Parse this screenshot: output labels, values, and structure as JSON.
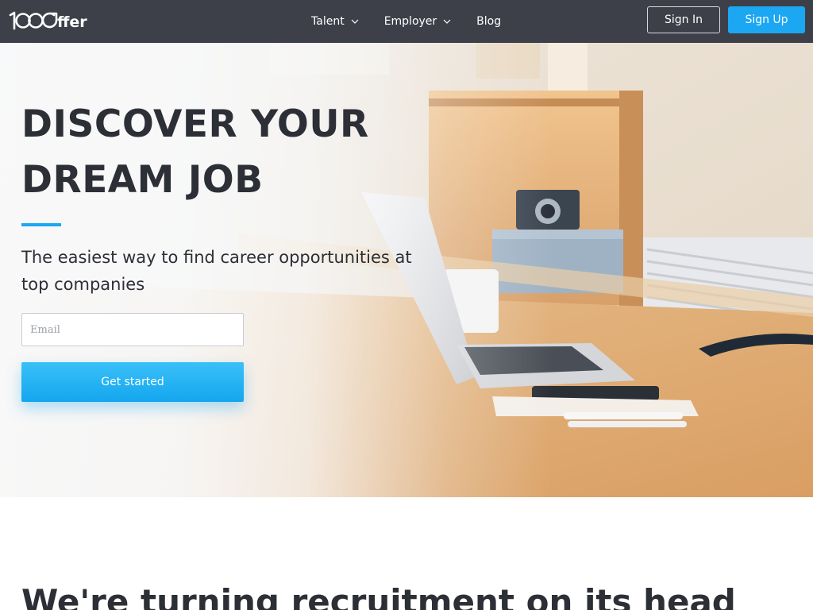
{
  "header": {
    "logo_text": "100ffer",
    "nav": [
      {
        "label": "Talent",
        "has_dropdown": true
      },
      {
        "label": "Employer",
        "has_dropdown": true
      },
      {
        "label": "Blog",
        "has_dropdown": false
      }
    ],
    "sign_in_label": "Sign In",
    "sign_up_label": "Sign Up"
  },
  "hero": {
    "title_line1": "DISCOVER YOUR",
    "title_line2": "DREAM JOB",
    "subtitle": "The easiest way to find career opportunities at top companies",
    "email_placeholder": "Email",
    "cta_label": "Get started"
  },
  "section2": {
    "title": "We're turning recruitment on its head"
  },
  "colors": {
    "header_bg": "#3d4049",
    "accent": "#1ba7f1",
    "text_dark": "#2c2f36"
  }
}
